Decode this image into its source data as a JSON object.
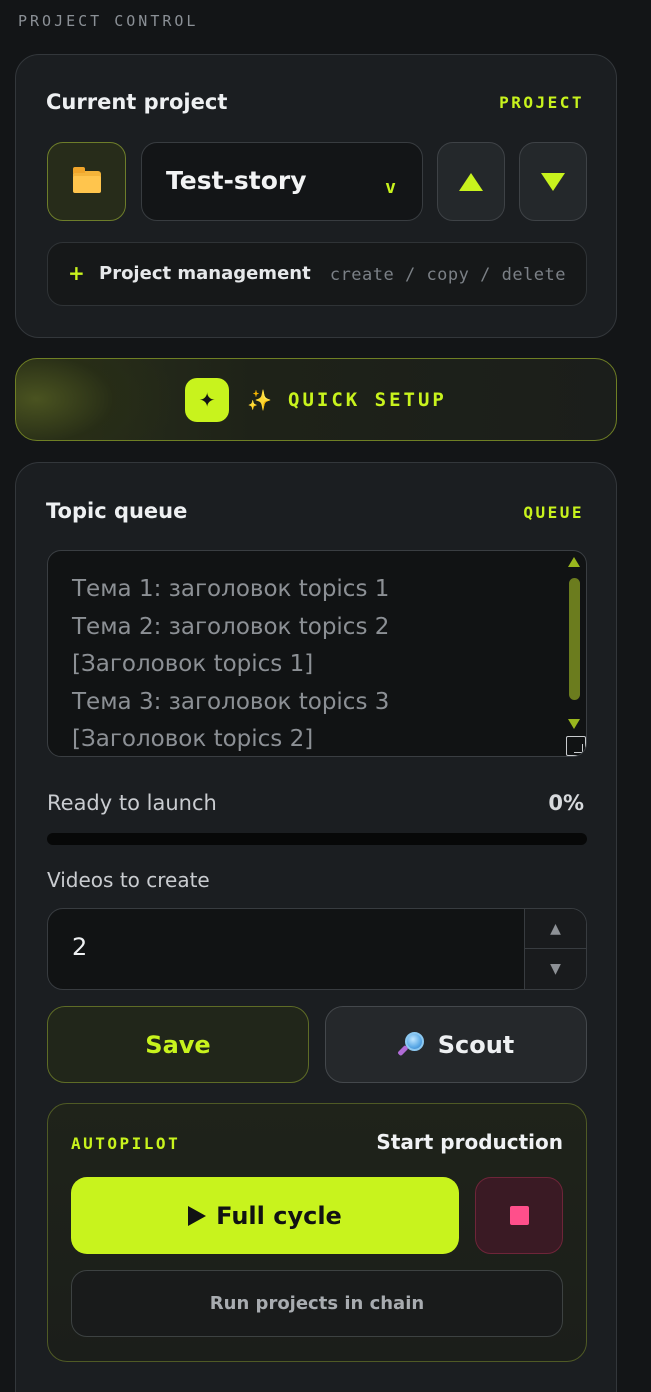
{
  "header": {
    "section_label": "PROJECT CONTROL"
  },
  "project": {
    "title": "Current project",
    "tag": "PROJECT",
    "selected_project": "Test-story",
    "select_chevron": "v",
    "management_plus": "+",
    "management_label": "Project management",
    "management_hint": "create / copy / delete"
  },
  "quick_setup": {
    "badge_glyph": "✦",
    "sparkle_glyph": "✨",
    "label": "QUICK SETUP"
  },
  "queue": {
    "title": "Topic queue",
    "tag": "QUEUE",
    "topics_text": "Тема 1: заголовок topics 1\nТема 2: заголовок topics 2\n[Заголовок topics 1]\nТема 3: заголовок topics 3\n[Заголовок topics 2]",
    "ready_label": "Ready to launch",
    "ready_percent": "0%",
    "progress": 0,
    "videos_label": "Videos to create",
    "videos_value": "2",
    "stepper_up": "▲",
    "stepper_down": "▼",
    "save_label": "Save",
    "scout_label": "Scout"
  },
  "autopilot": {
    "tag": "AUTOPILOT",
    "title": "Start production",
    "full_cycle_label": "Full cycle",
    "chain_label": "Run projects in chain"
  },
  "colors": {
    "accent": "#c8f31d",
    "background": "#131517",
    "card": "#1b1e21",
    "stop": "#ff4f8b"
  },
  "icons": [
    "folder-icon",
    "triangle-up-icon",
    "triangle-down-icon",
    "plus-icon",
    "sparkle-icon",
    "magnifier-icon",
    "play-icon",
    "stop-icon"
  ]
}
